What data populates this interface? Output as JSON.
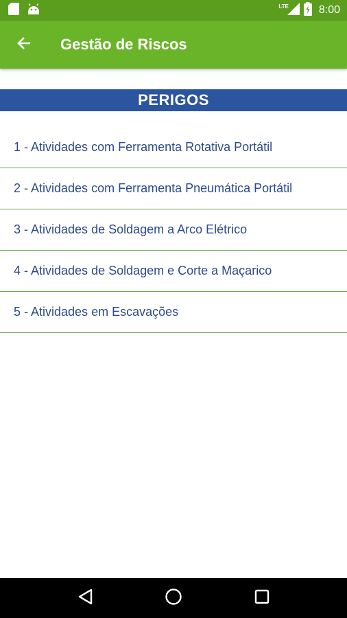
{
  "status_bar": {
    "time": "8:00",
    "network_label": "LTE",
    "icons": [
      "sd-card-icon",
      "android-icon",
      "signal-icon",
      "battery-icon"
    ]
  },
  "app_bar": {
    "title": "Gestão de Riscos",
    "back_icon": "arrow-back-icon",
    "color": "#6ab42a"
  },
  "section": {
    "title": "PERIGOS",
    "color": "#2c55a0"
  },
  "hazards": [
    "1 - Atividades com Ferramenta Rotativa Portátil",
    "2 - Atividades com Ferramenta Pneumática Portátil",
    "3 - Atividades de Soldagem a Arco Elétrico",
    "4 - Atividades de Soldagem e Corte a Maçarico",
    "5 - Atividades em Escavações"
  ],
  "nav_bar": {
    "icons": [
      "back-triangle-icon",
      "home-circle-icon",
      "recents-square-icon"
    ]
  }
}
